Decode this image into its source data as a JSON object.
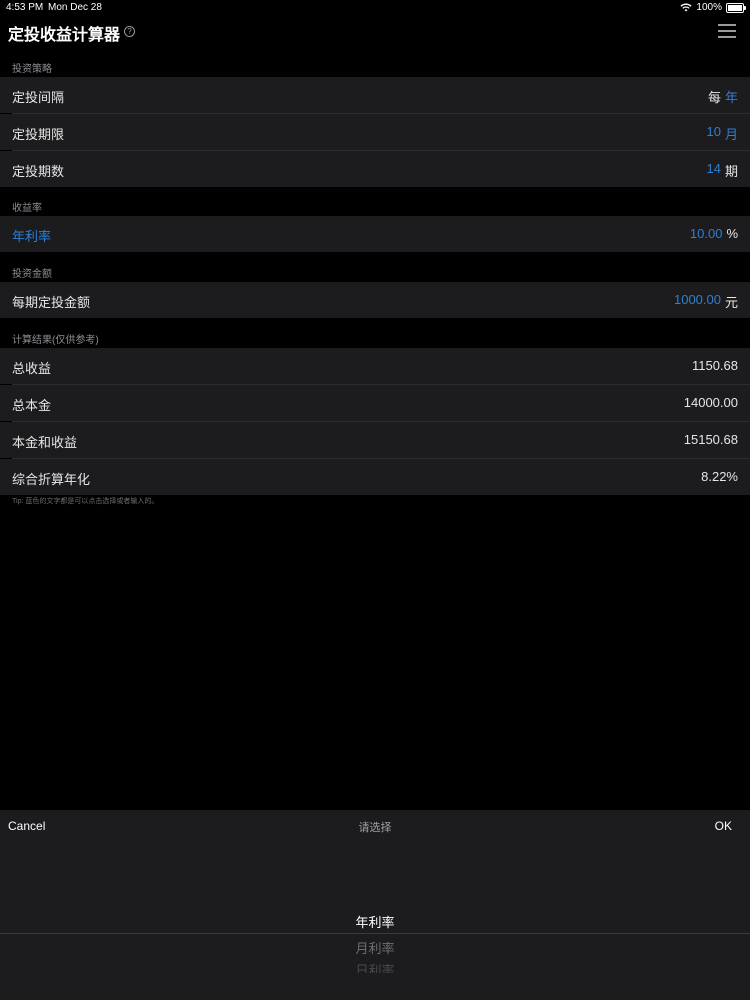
{
  "status_bar": {
    "time": "4:53 PM",
    "date": "Mon Dec 28",
    "battery": "100%",
    "icons": [
      "wifi-icon",
      "battery-icon"
    ]
  },
  "header": {
    "title": "定投收益计算器",
    "help_icon": "?",
    "menu_icon": "hamburger-menu-icon"
  },
  "sections": {
    "strategy": {
      "header": "投资策略",
      "rows": [
        {
          "label": "定投间隔",
          "prefix": "每",
          "value": "年",
          "suffix": ""
        },
        {
          "label": "定投期限",
          "prefix": "",
          "value": "10",
          "suffix": "月"
        },
        {
          "label": "定投期数",
          "prefix": "",
          "value": "14",
          "suffix": "期"
        }
      ]
    },
    "rate": {
      "header": "收益率",
      "label": "年利率",
      "value": "10.00",
      "unit": "%"
    },
    "amount": {
      "header": "投资金额",
      "label": "每期定投金额",
      "value": "1000.00",
      "unit": "元"
    },
    "results": {
      "header": "计算结果(仅供参考)",
      "rows": [
        {
          "label": "总收益",
          "value": "1150.68"
        },
        {
          "label": "总本金",
          "value": "14000.00"
        },
        {
          "label": "本金和收益",
          "value": "15150.68"
        },
        {
          "label": "综合折算年化",
          "value": "8.22%"
        }
      ]
    }
  },
  "tip": "Tip: 蓝色的文字都是可以点击选择或者输入的。",
  "picker": {
    "cancel": "Cancel",
    "title": "请选择",
    "ok": "OK",
    "options": [
      "年利率",
      "月利率",
      "日利率"
    ],
    "selected_index": 0
  },
  "colors": {
    "accent_blue": "#2f7fd4",
    "row_background": "#1c1c1e",
    "page_background": "#000000"
  }
}
